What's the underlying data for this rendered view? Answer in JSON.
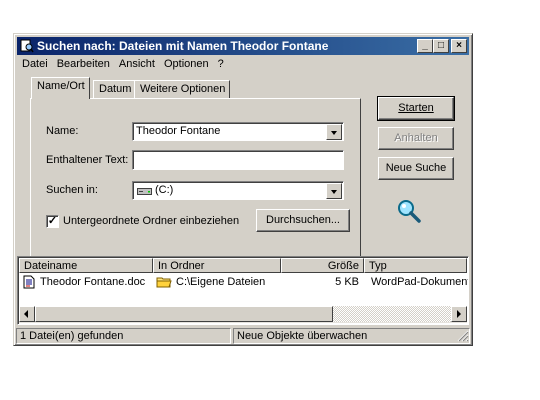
{
  "window": {
    "title": "Suchen nach: Dateien mit Namen Theodor Fontane",
    "minimize": "_",
    "maximize": "□",
    "close": "×"
  },
  "menu": {
    "items": [
      {
        "label": "Datei"
      },
      {
        "label": "Bearbeiten"
      },
      {
        "label": "Ansicht"
      },
      {
        "label": "Optionen"
      },
      {
        "label": "?"
      }
    ]
  },
  "tabs": [
    {
      "label": "Name/Ort",
      "active": true
    },
    {
      "label": "Datum",
      "active": false
    },
    {
      "label": "Weitere Optionen",
      "active": false
    }
  ],
  "form": {
    "name_label": "Name:",
    "name_value": "Theodor Fontane",
    "text_label": "Enthaltener Text:",
    "text_value": "",
    "search_in_label": "Suchen in:",
    "search_in_value": "(C:)",
    "subfolders_label": "Untergeordnete Ordner einbeziehen",
    "subfolders_checked": true,
    "browse_label": "Durchsuchen..."
  },
  "buttons": {
    "start": "Starten",
    "stop": "Anhalten",
    "new_search": "Neue Suche"
  },
  "results": {
    "columns": [
      "Dateiname",
      "In Ordner",
      "Größe",
      "Typ"
    ],
    "rows": [
      {
        "name": "Theodor Fontane.doc",
        "folder": "C:\\Eigene Dateien",
        "size": "5 KB",
        "type": "WordPad-Dokument"
      }
    ]
  },
  "status": {
    "found": "1 Datei(en) gefunden",
    "monitor": "Neue Objekte überwachen"
  },
  "colors": {
    "title_start": "#0a246a",
    "title_end": "#3a6ea5",
    "face": "#d4d0c8"
  }
}
